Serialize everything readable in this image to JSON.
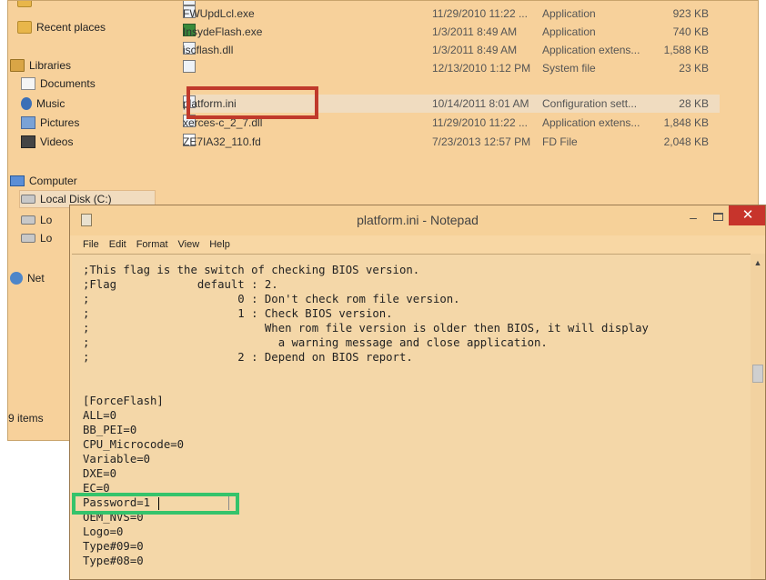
{
  "explorer": {
    "nav": {
      "recent_places": "Recent places",
      "libraries": "Libraries",
      "documents": "Documents",
      "music": "Music",
      "pictures": "Pictures",
      "videos": "Videos",
      "computer": "Computer",
      "local_disk": "Local Disk (C:)",
      "disk2_partial": "Lo",
      "disk3_partial": "Lo",
      "network_partial": "Net"
    },
    "status": "9 items",
    "files": [
      {
        "name": "FWUpdLcl.exe",
        "date": "11/29/2010 11:22 ...",
        "type": "Application",
        "size": "923 KB"
      },
      {
        "name": "InsydeFlash.exe",
        "date": "1/3/2011 8:49 AM",
        "type": "Application",
        "size": "740 KB"
      },
      {
        "name": "iscflash.dll",
        "date": "1/3/2011 8:49 AM",
        "type": "Application extens...",
        "size": "1,588 KB"
      },
      {
        "name": "",
        "date": "12/13/2010 1:12 PM",
        "type": "System file",
        "size": "23 KB"
      },
      {
        "name": "platform.ini",
        "date": "10/14/2011 8:01 AM",
        "type": "Configuration sett...",
        "size": "28 KB"
      },
      {
        "name": "xerces-c_2_7.dll",
        "date": "11/29/2010 11:22 ...",
        "type": "Application extens...",
        "size": "1,848 KB"
      },
      {
        "name": "ZE7IA32_110.fd",
        "date": "7/23/2013 12:57 PM",
        "type": "FD File",
        "size": "2,048 KB"
      }
    ]
  },
  "notepad": {
    "title": "platform.ini - Notepad",
    "menu": [
      "File",
      "Edit",
      "Format",
      "View",
      "Help"
    ],
    "lines": [
      ";This flag is the switch of checking BIOS version.",
      ";Flag            default : 2.",
      ";                      0 : Don't check rom file version.",
      ";                      1 : Check BIOS version.",
      ";                          When rom file version is older then BIOS, it will display",
      ";                            a warning message and close application.",
      ";                      2 : Depend on BIOS report.",
      "",
      "",
      "[ForceFlash]",
      "ALL=0",
      "BB_PEI=0",
      "CPU_Microcode=0",
      "Variable=0",
      "DXE=0",
      "EC=0",
      "Password=1",
      "OEM_NVS=0",
      "Logo=0",
      "Type#09=0",
      "Type#08=0"
    ]
  },
  "colors": {
    "window_bg": "#f7d19b",
    "highlight_red": "#c0392b",
    "highlight_green": "#35c36b",
    "close_button": "#c7342c"
  }
}
